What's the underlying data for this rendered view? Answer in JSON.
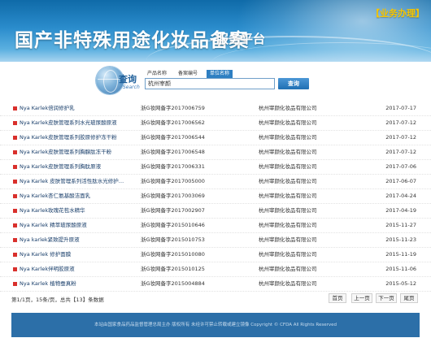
{
  "header": {
    "title": "国产非特殊用途化妆品备案",
    "subtitle": "服务平台",
    "biz_link": "【业务办理】"
  },
  "search": {
    "label": "查询",
    "label_en": "Search",
    "tabs": [
      {
        "label": "产品名称",
        "active": false
      },
      {
        "label": "备案编号",
        "active": false
      },
      {
        "label": "单位名称",
        "active": true
      }
    ],
    "input_value": "杭州宰颜",
    "button_label": "查询"
  },
  "results": [
    {
      "name": "Nya Karlek倍润修护乳",
      "reg": "浙G妆网备字2017006759",
      "company": "杭州宰颜化妆品有限公司",
      "date": "2017-07-17"
    },
    {
      "name": "Nya Karlek皮肤管理系列水光玻尿酸原液",
      "reg": "浙G妆网备字2017006562",
      "company": "杭州宰颜化妆品有限公司",
      "date": "2017-07-12"
    },
    {
      "name": "Nya Karlek皮肤管理系列胶原修护冻干粉",
      "reg": "浙G妆网备字2017006544",
      "company": "杭州宰颜化妆品有限公司",
      "date": "2017-07-12"
    },
    {
      "name": "Nya Karlek皮肤管理系列胸腺肽冻干粉",
      "reg": "浙G妆网备字2017006548",
      "company": "杭州宰颜化妆品有限公司",
      "date": "2017-07-12"
    },
    {
      "name": "Nya Karlek皮肤管理系列胸肽原液",
      "reg": "浙G妆网备字2017006331",
      "company": "杭州宰颜化妆品有限公司",
      "date": "2017-07-06"
    },
    {
      "name": "Nya Karlek 皮肤管理系列活性肽水光修护…",
      "reg": "浙G妆网备字2017005000",
      "company": "杭州宰颜化妆品有限公司",
      "date": "2017-06-07"
    },
    {
      "name": "Nya Karlek杏仁氨基酸洁面乳",
      "reg": "浙G妆网备字2017003069",
      "company": "杭州宰颜化妆品有限公司",
      "date": "2017-04-24"
    },
    {
      "name": "Nya Karlek玫瑰花苞水精华",
      "reg": "浙G妆网备字2017002907",
      "company": "杭州宰颜化妆品有限公司",
      "date": "2017-04-19"
    },
    {
      "name": "Nya Karlek 精萃玻尿酸原液",
      "reg": "浙G妆网备字2015010646",
      "company": "杭州宰颜化妆品有限公司",
      "date": "2015-11-27"
    },
    {
      "name": "Nya karlek紧致提升原液",
      "reg": "浙G妆网备字2015010753",
      "company": "杭州宰颜化妆品有限公司",
      "date": "2015-11-23"
    },
    {
      "name": "Nya Karlek 修护面膜",
      "reg": "浙G妆网备字2015010080",
      "company": "杭州宰颜化妆品有限公司",
      "date": "2015-11-19"
    },
    {
      "name": "Nya Karlek伴明胶原液",
      "reg": "浙G妆网备字2015010125",
      "company": "杭州宰颜化妆品有限公司",
      "date": "2015-11-06"
    },
    {
      "name": "Nya Karlek 植物蚕真粉",
      "reg": "浙G妆网备字2015004884",
      "company": "杭州宰颜化妆品有限公司",
      "date": "2015-05-12"
    }
  ],
  "pager": {
    "info": "第1/1页，15条/页，总共【13】条数据",
    "first": "首页",
    "prev": "上一页",
    "next": "下一页",
    "last": "尾页"
  },
  "footer": {
    "text": "本站由国家食品药品监督管理总局主办 版权所有 未经许可禁止转载或建立镜像 Copyright © CFDA All Rights Reserved"
  },
  "colors": {
    "banner": "#2a8ccc",
    "accent": "#2e7fc2",
    "bullet": "#d9302c",
    "biz_link": "#f7c600",
    "footer": "#2c6fa8"
  }
}
